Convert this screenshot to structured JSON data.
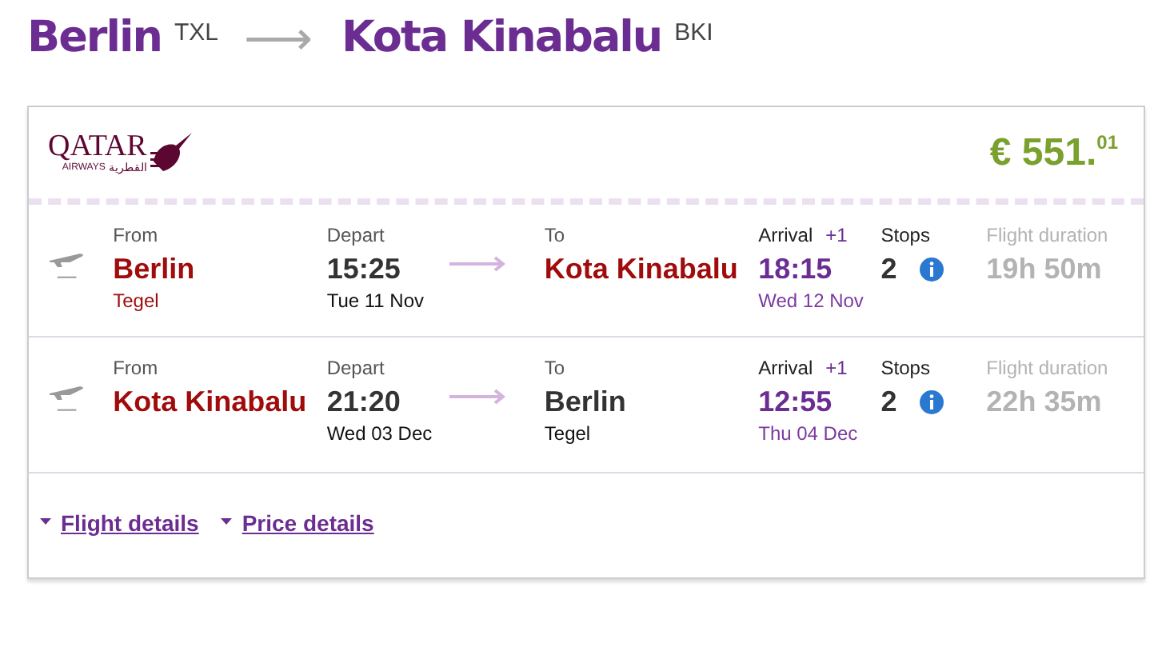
{
  "route": {
    "origin": "Berlin",
    "origin_code": "TXL",
    "arrow": "⟶",
    "destination": "Kota Kinabalu",
    "destination_code": "BKI"
  },
  "airline": {
    "name": "QATAR",
    "sub": "AIRWAYS",
    "arabic": "القطرية"
  },
  "price": {
    "whole": "€ 551.",
    "cents": "01"
  },
  "legs": [
    {
      "from_label": "From",
      "from_city": "Berlin",
      "from_highlight": true,
      "from_airport": "Tegel",
      "depart_label": "Depart",
      "depart_time": "15:25",
      "depart_date": "Tue 11 Nov",
      "to_label": "To",
      "to_city": "Kota Kinabalu",
      "to_highlight": true,
      "arrival_label": "Arrival",
      "day_offset": "+1",
      "arrival_time": "18:15",
      "arrival_date": "Wed 12 Nov",
      "stops_label": "Stops",
      "stops": "2",
      "duration_label": "Flight duration",
      "duration": "19h 50m"
    },
    {
      "from_label": "From",
      "from_city": "Kota Kinabalu",
      "from_highlight": true,
      "depart_label": "Depart",
      "depart_time": "21:20",
      "depart_date": "Wed 03 Dec",
      "to_label": "To",
      "to_city": "Berlin",
      "to_highlight": false,
      "to_airport": "Tegel",
      "arrival_label": "Arrival",
      "day_offset": "+1",
      "arrival_time": "12:55",
      "arrival_date": "Thu 04 Dec",
      "stops_label": "Stops",
      "stops": "2",
      "duration_label": "Flight duration",
      "duration": "22h 35m"
    }
  ],
  "links": [
    "Flight details",
    "Price details"
  ]
}
